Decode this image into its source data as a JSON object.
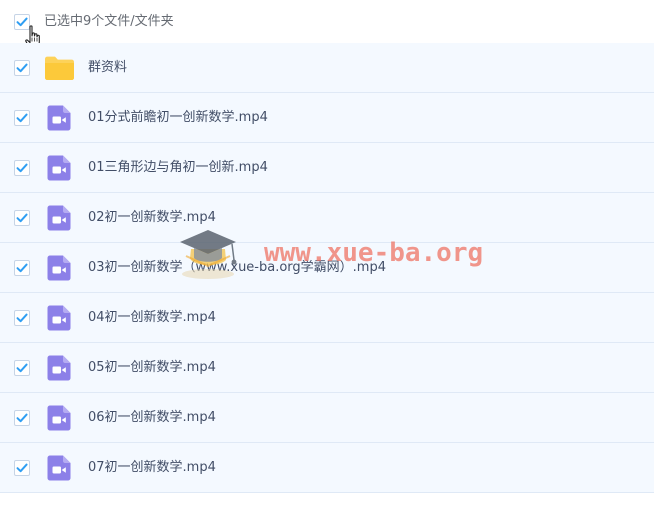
{
  "header": {
    "select_all_checked": true,
    "selection_text": "已选中9个文件/文件夹"
  },
  "files": [
    {
      "type": "folder",
      "name": "群资料",
      "checked": true
    },
    {
      "type": "video",
      "name": "01分式前瞻初一创新数学.mp4",
      "checked": true
    },
    {
      "type": "video",
      "name": "01三角形边与角初一创新.mp4",
      "checked": true
    },
    {
      "type": "video",
      "name": "02初一创新数学.mp4",
      "checked": true
    },
    {
      "type": "video",
      "name": "03初一创新数学（www.xue-ba.org学霸网）.mp4",
      "checked": true
    },
    {
      "type": "video",
      "name": "04初一创新数学.mp4",
      "checked": true
    },
    {
      "type": "video",
      "name": "05初一创新数学.mp4",
      "checked": true
    },
    {
      "type": "video",
      "name": "06初一创新数学.mp4",
      "checked": true
    },
    {
      "type": "video",
      "name": "07初一创新数学.mp4",
      "checked": true
    }
  ],
  "watermark": {
    "text": "www.xue-ba.org"
  },
  "colors": {
    "check": "#2f9ef3",
    "folder": "#fdd259",
    "video": "#8c80e8",
    "row_bg": "#f4f9ff",
    "divider": "#dfe9f6"
  }
}
